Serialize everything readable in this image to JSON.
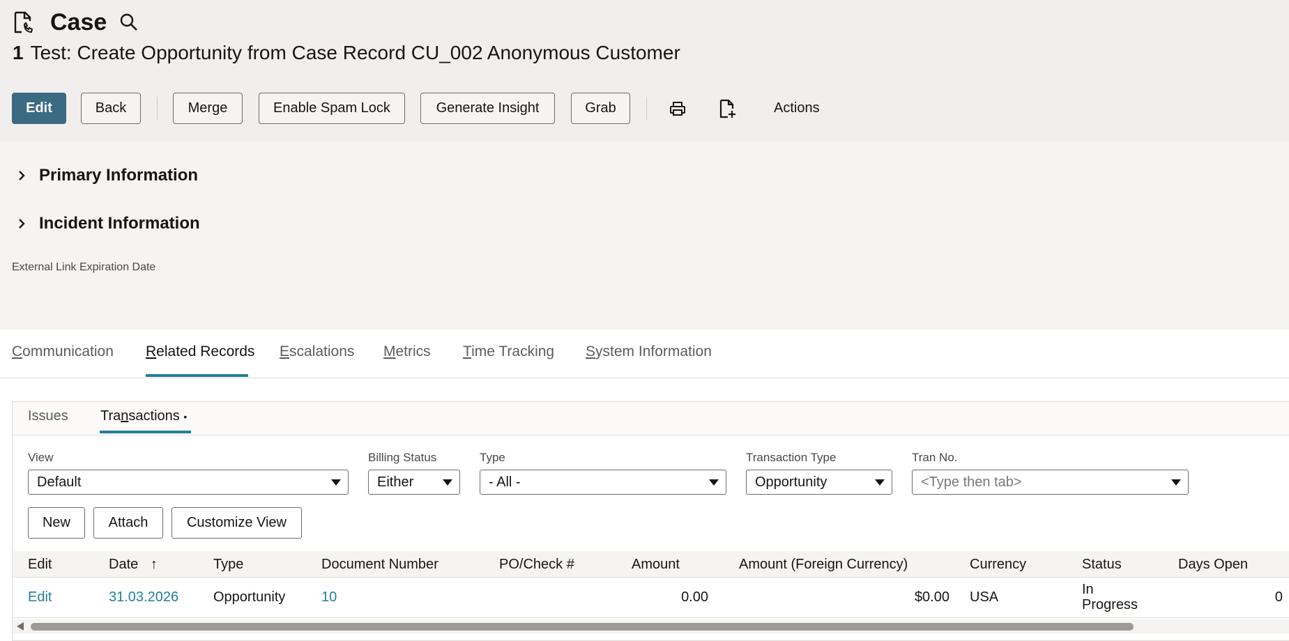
{
  "header": {
    "title": "Case",
    "record_number": "1",
    "record_title": "Test: Create Opportunity from Case Record CU_002 Anonymous Customer"
  },
  "toolbar": {
    "edit_label": "Edit",
    "back_label": "Back",
    "merge_label": "Merge",
    "spam_lock_label": "Enable Spam Lock",
    "insight_label": "Generate Insight",
    "grab_label": "Grab",
    "actions_label": "Actions"
  },
  "sections": {
    "primary": "Primary Information",
    "incident": "Incident Information",
    "external_link_label": "External Link Expiration Date"
  },
  "tabs": {
    "communication": {
      "first": "C",
      "rest": "ommunication"
    },
    "related": {
      "first": "R",
      "rest": "elated Records"
    },
    "escalations": {
      "first": "E",
      "rest": "scalations"
    },
    "metrics": {
      "first": "M",
      "rest": "etrics"
    },
    "time": {
      "first": "T",
      "rest": "ime Tracking"
    },
    "system": {
      "first": "S",
      "rest": "ystem Information"
    }
  },
  "subtabs": {
    "issues": "Issues",
    "transactions_pre": "Tra",
    "transactions_u": "n",
    "transactions_post": "sactions",
    "transactions_dot": "•"
  },
  "filters": {
    "view_label": "View",
    "view_value": "Default",
    "billing_label": "Billing Status",
    "billing_value": "Either",
    "type_label": "Type",
    "type_value": "- All -",
    "tran_type_label": "Transaction Type",
    "tran_type_value": "Opportunity",
    "tran_no_label": "Tran No.",
    "tran_no_placeholder": "<Type then tab>"
  },
  "list_buttons": {
    "new": "New",
    "attach": "Attach",
    "customize": "Customize View"
  },
  "table": {
    "columns": [
      "Edit",
      "Date",
      "Type",
      "Document Number",
      "PO/Check #",
      "Amount",
      "Amount (Foreign Currency)",
      "Currency",
      "Status",
      "Days Open"
    ],
    "sort_arrow": "↑",
    "rows": [
      {
        "edit": "Edit",
        "date": "31.03.2026",
        "type": "Opportunity",
        "document_number": "10",
        "po_check": "",
        "amount": "0.00",
        "amount_foreign": "$0.00",
        "currency": "USA",
        "status_line1": "In",
        "status_line2": "Progress",
        "days_open": "0"
      }
    ]
  },
  "colors": {
    "primary_button": "#3a6b82",
    "accent": "#227e9e",
    "header_bg": "#f1efed"
  },
  "icons": {
    "record": "case-record-icon",
    "search": "search-icon",
    "print": "print-icon",
    "new_document": "new-document-icon"
  }
}
